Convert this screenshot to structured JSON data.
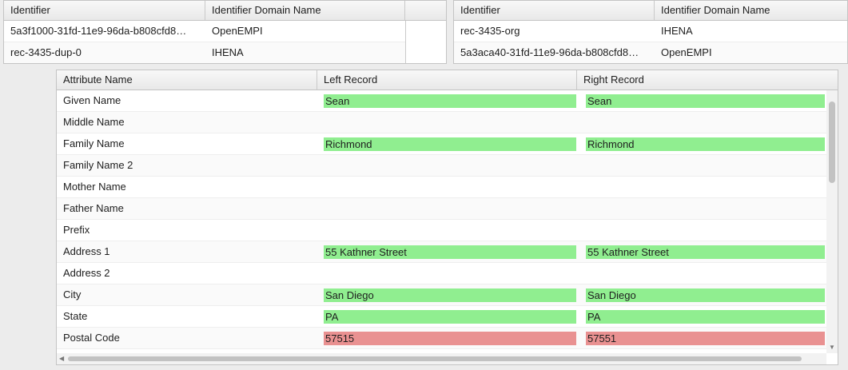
{
  "left_ids": {
    "headers": [
      "Identifier",
      "Identifier Domain Name"
    ],
    "rows": [
      [
        "5a3f1000-31fd-11e9-96da-b808cfd8…",
        "OpenEMPI"
      ],
      [
        "rec-3435-dup-0",
        "IHENA"
      ]
    ]
  },
  "right_ids": {
    "headers": [
      "Identifier",
      "Identifier Domain Name"
    ],
    "rows": [
      [
        "rec-3435-org",
        "IHENA"
      ],
      [
        "5a3aca40-31fd-11e9-96da-b808cfd8…",
        "OpenEMPI"
      ]
    ]
  },
  "attributes": {
    "headers": [
      "Attribute Name",
      "Left Record",
      "Right Record"
    ],
    "colors": {
      "match": "#90ee90",
      "mismatch": "#e99191"
    },
    "rows": [
      {
        "name": "Given Name",
        "left": "Sean",
        "right": "Sean",
        "status": "match"
      },
      {
        "name": "Middle Name",
        "left": "",
        "right": "",
        "status": "none"
      },
      {
        "name": "Family Name",
        "left": "Richmond",
        "right": "Richmond",
        "status": "match"
      },
      {
        "name": "Family Name 2",
        "left": "",
        "right": "",
        "status": "none"
      },
      {
        "name": "Mother Name",
        "left": "",
        "right": "",
        "status": "none"
      },
      {
        "name": "Father Name",
        "left": "",
        "right": "",
        "status": "none"
      },
      {
        "name": "Prefix",
        "left": "",
        "right": "",
        "status": "none"
      },
      {
        "name": "Address 1",
        "left": "55 Kathner Street",
        "right": "55 Kathner Street",
        "status": "match"
      },
      {
        "name": "Address 2",
        "left": "",
        "right": "",
        "status": "none"
      },
      {
        "name": "City",
        "left": "San Diego",
        "right": "San Diego",
        "status": "match"
      },
      {
        "name": "State",
        "left": "PA",
        "right": "PA",
        "status": "match"
      },
      {
        "name": "Postal Code",
        "left": "57515",
        "right": "57551",
        "status": "mismatch"
      }
    ]
  }
}
